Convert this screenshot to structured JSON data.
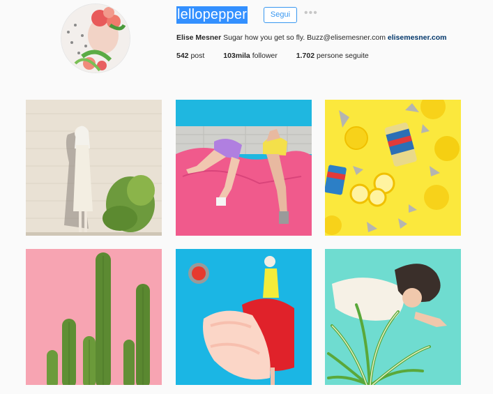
{
  "profile": {
    "username": "lellopepper",
    "follow_label": "Segui",
    "more_label": "•••",
    "full_name": "Elise Mesner",
    "bio_text": "Sugar how you get so fly. Buzz@elisemesner.com",
    "website": "elisemesner.com",
    "stats": [
      {
        "value": "542",
        "label": "post"
      },
      {
        "value": "103mila",
        "label": "follower"
      },
      {
        "value": "1.702",
        "label": "persone seguite"
      }
    ]
  },
  "colors": {
    "accent": "#3897f0",
    "selection": "#3390ff",
    "link": "#003569",
    "background": "#fafafa"
  },
  "posts": [
    {
      "name": "post-1",
      "alt_icon": "photo-girl-white-dress"
    },
    {
      "name": "post-2",
      "alt_icon": "photo-legs-pink-cloth"
    },
    {
      "name": "post-3",
      "alt_icon": "photo-lemons-cans"
    },
    {
      "name": "post-4",
      "alt_icon": "photo-cactus-pink"
    },
    {
      "name": "post-5",
      "alt_icon": "photo-red-skirt-blue"
    },
    {
      "name": "post-6",
      "alt_icon": "photo-plant-turquoise"
    }
  ]
}
